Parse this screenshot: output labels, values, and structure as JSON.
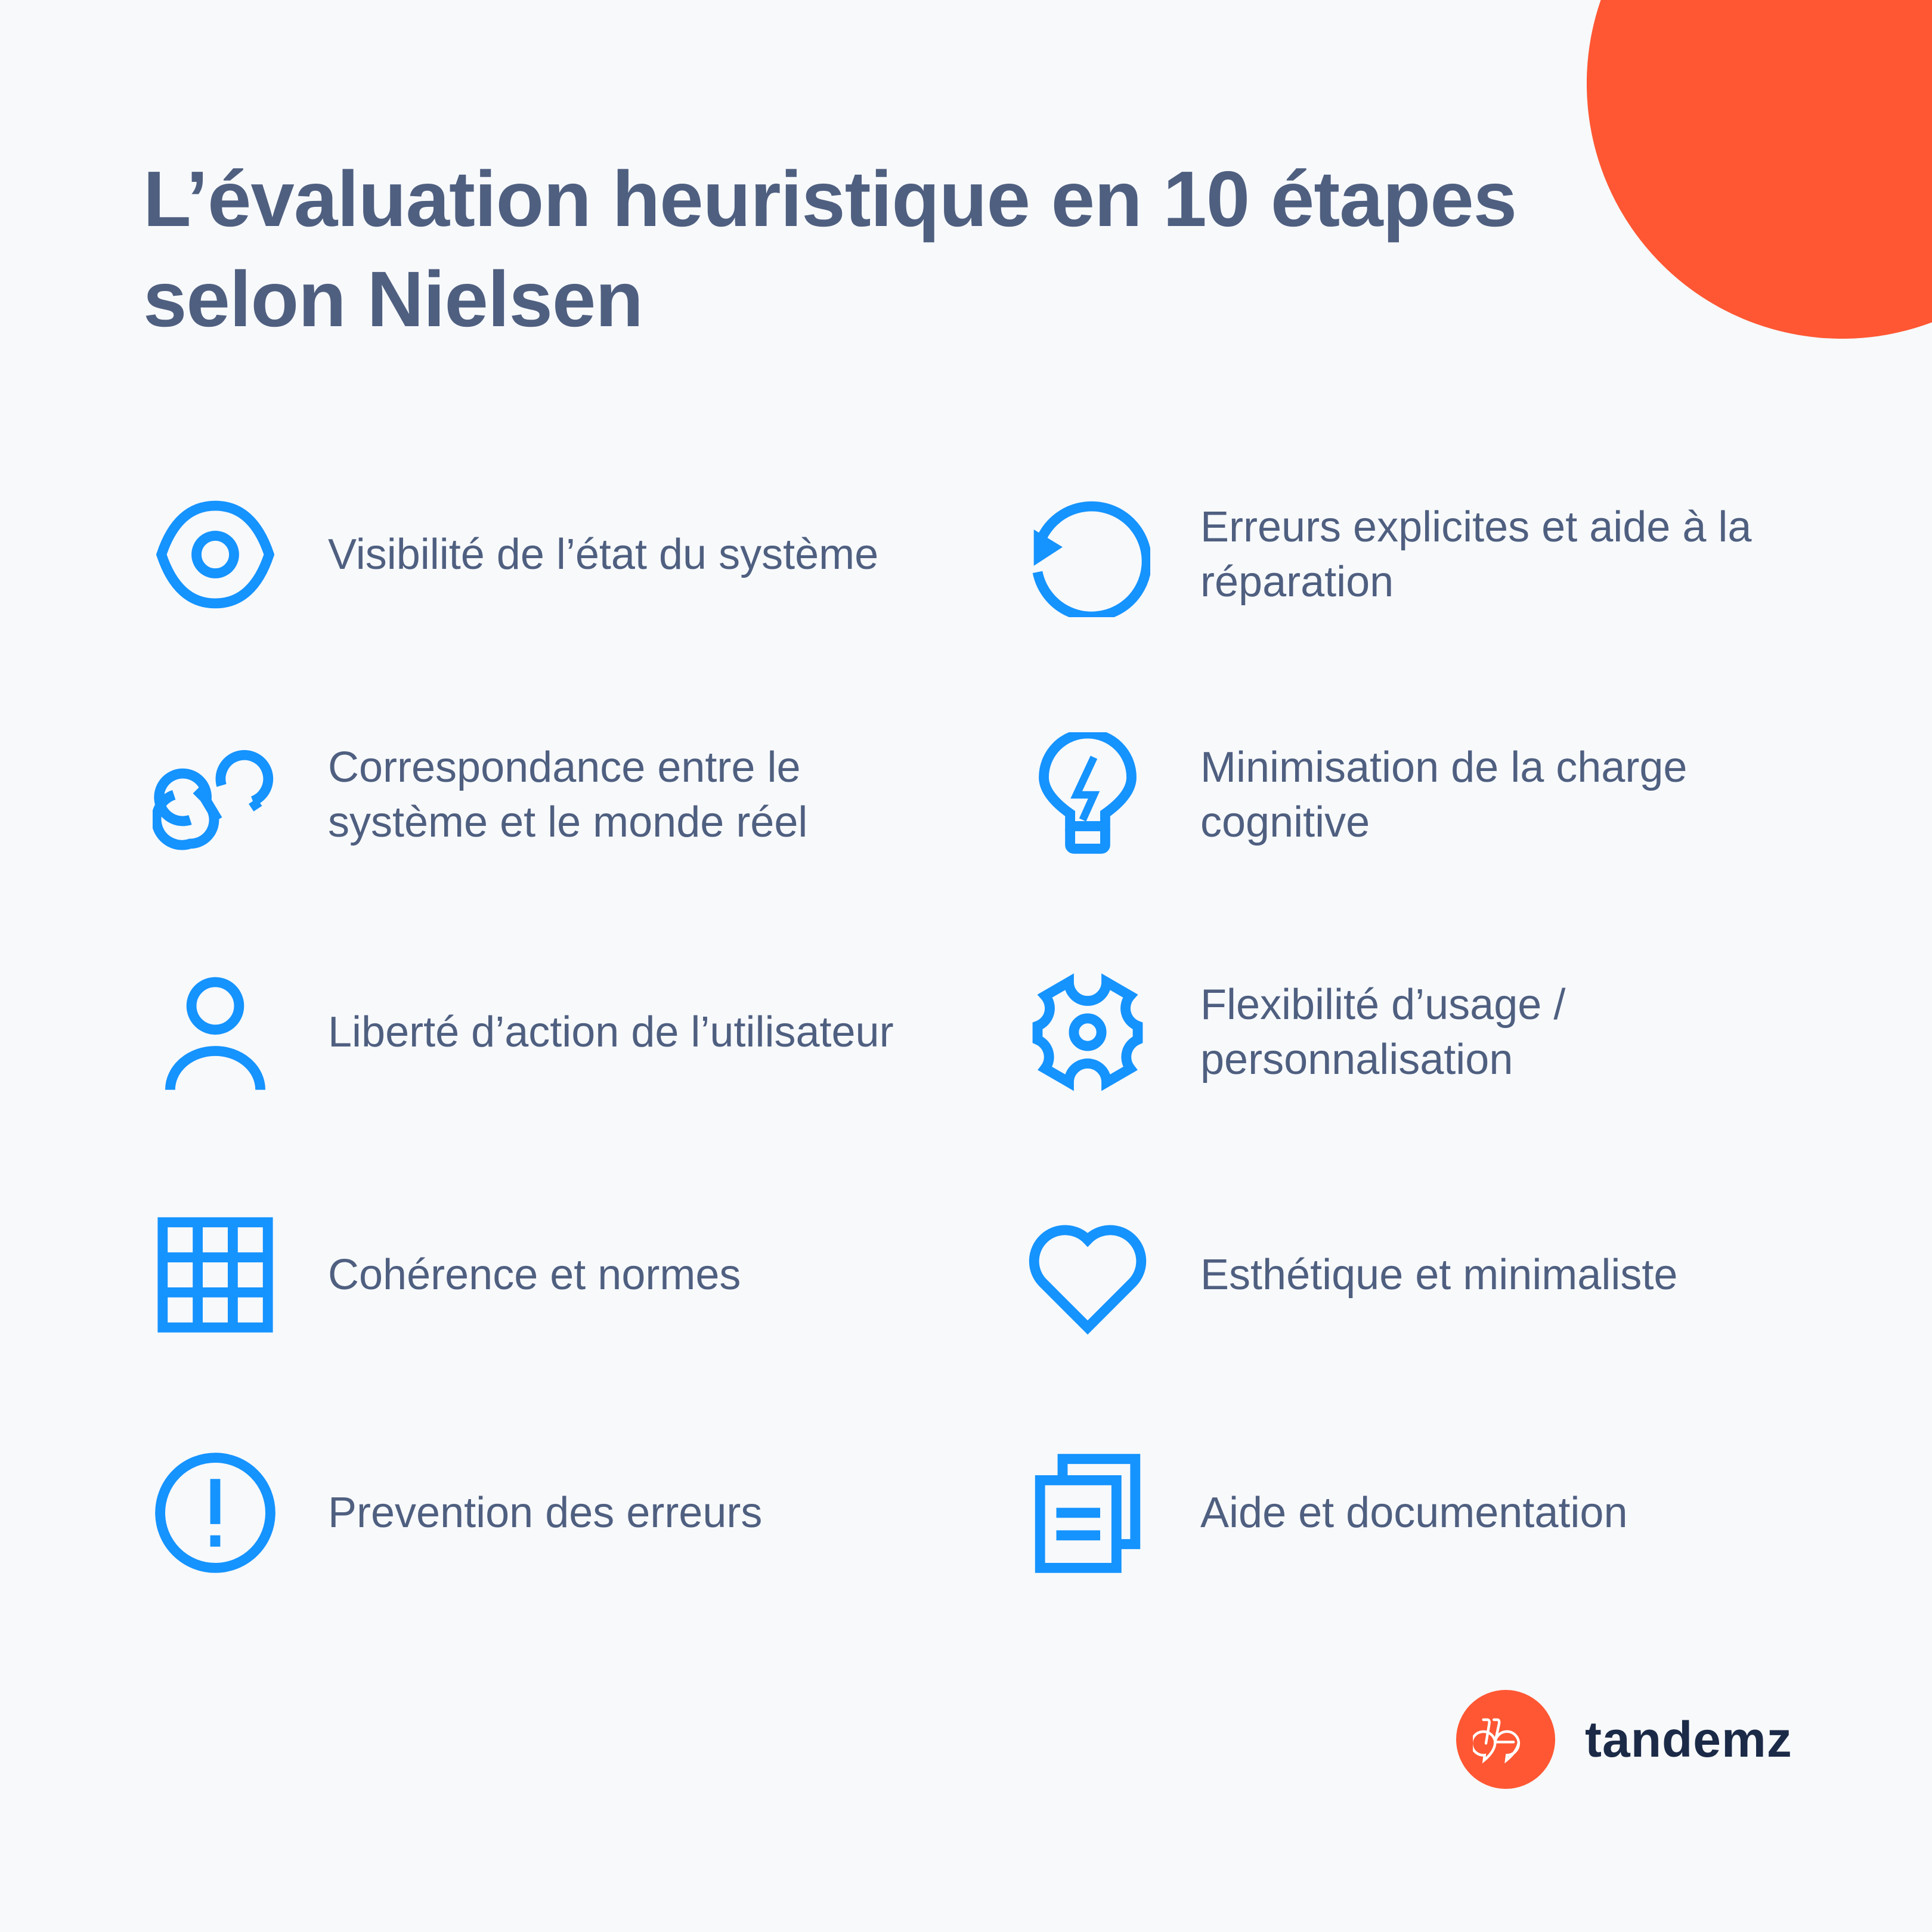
{
  "title": "L’évaluation heuristique en 10 étapes selon Nielsen",
  "colors": {
    "accent": "#1593FF",
    "brand": "#FF5733",
    "text": "#4F5F80",
    "logo_text": "#1B2A47",
    "background": "#F7F9FB"
  },
  "items": [
    {
      "icon": "eye-icon",
      "label": "Visibilité de l’état du système"
    },
    {
      "icon": "link-icon",
      "label": "Correspondance entre le système et le monde réel"
    },
    {
      "icon": "user-icon",
      "label": "Liberté d’action de l’utilisateur"
    },
    {
      "icon": "grid-icon",
      "label": "Cohérence et normes"
    },
    {
      "icon": "exclamation-circle-icon",
      "label": "Prevention des erreurs"
    },
    {
      "icon": "undo-icon",
      "label": "Erreurs explicites et aide à la réparation"
    },
    {
      "icon": "lightbulb-icon",
      "label": "Minimisation de la charge cognitive"
    },
    {
      "icon": "gear-icon",
      "label": "Flexibilité d’usage / personnalisation"
    },
    {
      "icon": "heart-icon",
      "label": "Esthétique et minimaliste"
    },
    {
      "icon": "documents-icon",
      "label": "Aide et documentation"
    }
  ],
  "logo": {
    "text": "tandemz",
    "icon": "tandem-bike-icon"
  }
}
